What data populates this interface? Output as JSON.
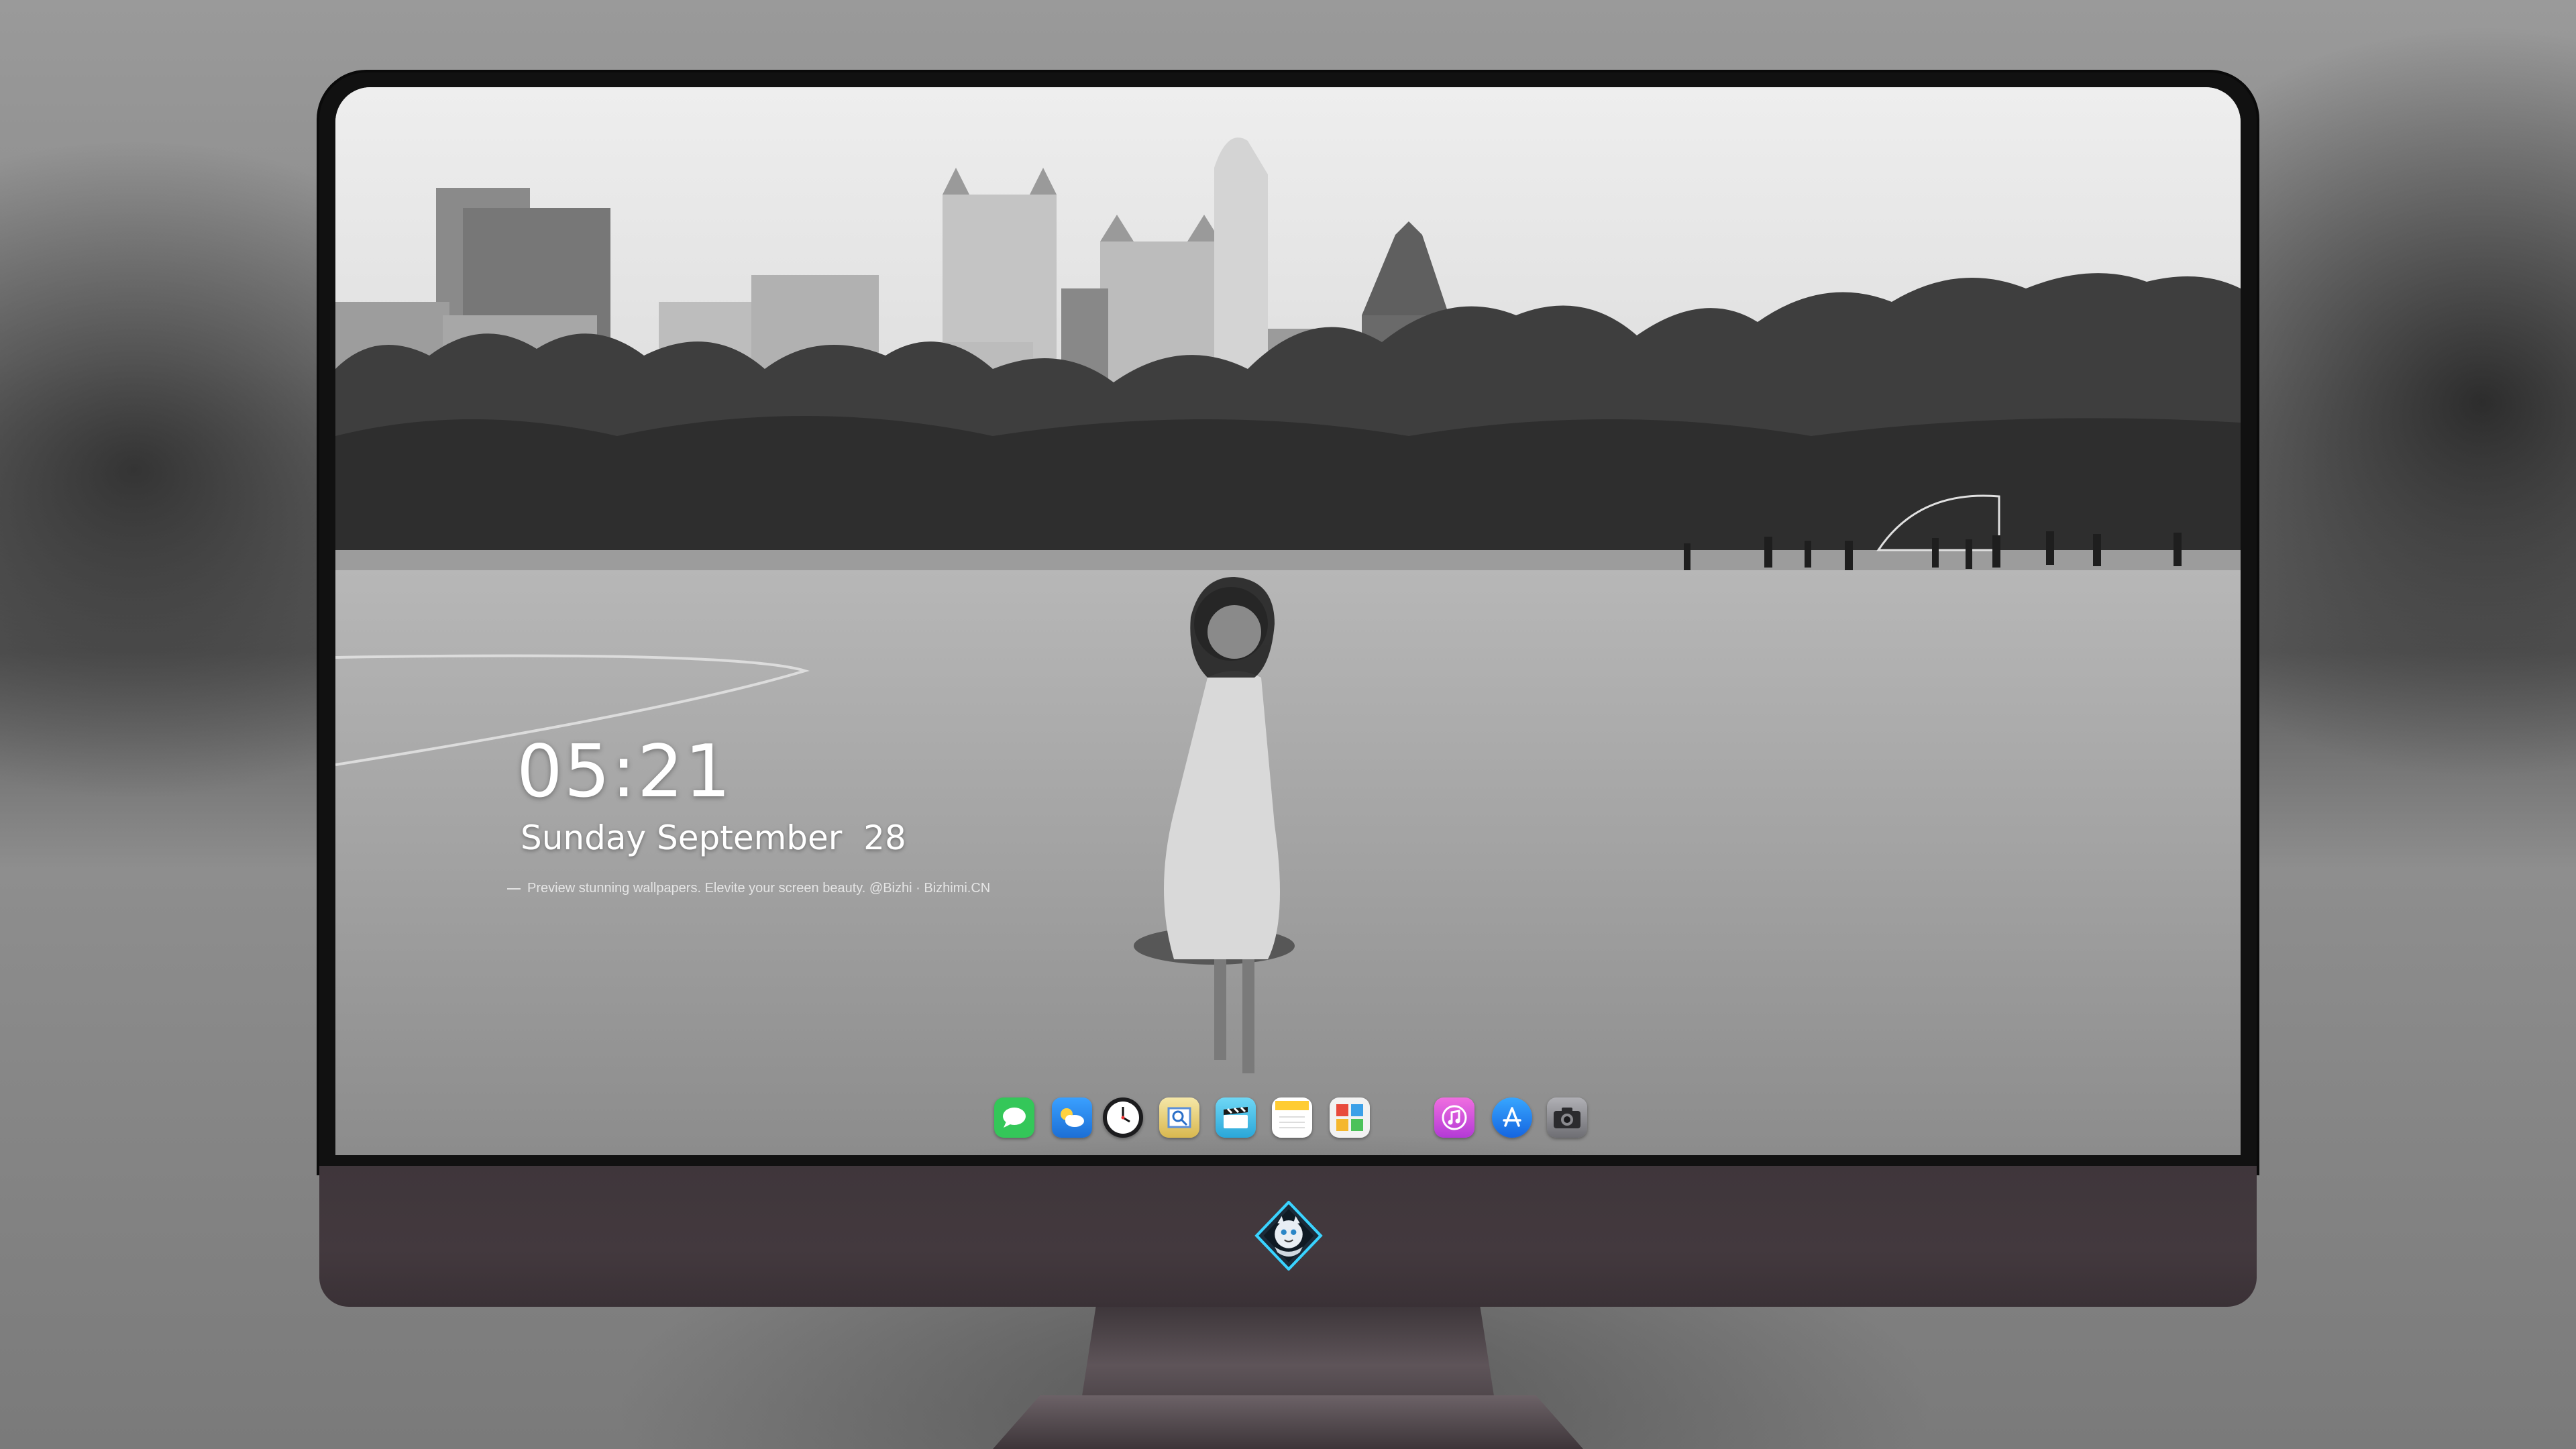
{
  "lockscreen": {
    "time": "05:21",
    "date": "Sunday September  28",
    "caption": "Preview stunning wallpapers. Elevite your screen beauty. @Bizhi · Bizhimi.CN"
  },
  "dock": {
    "apps": [
      {
        "name": "Messages",
        "icon": "messages-icon",
        "color": "#34c759"
      },
      {
        "name": "Weather",
        "icon": "weather-icon",
        "color": "#2f8ef0"
      },
      {
        "name": "Clock",
        "icon": "clock-icon",
        "color": "#1c1c1e"
      },
      {
        "name": "Preview",
        "icon": "preview-icon",
        "color": "#e8d27a"
      },
      {
        "name": "Clips",
        "icon": "clips-icon",
        "color": "#4fc3e8"
      },
      {
        "name": "Notes",
        "icon": "notes-icon",
        "color": "#ffd84a"
      },
      {
        "name": "Photo Booth",
        "icon": "photo-booth-icon",
        "color": "#f2f2f2"
      },
      {
        "name": "iTunes",
        "icon": "itunes-icon",
        "color": "#e74cd9"
      },
      {
        "name": "App Store",
        "icon": "app-store-icon",
        "color": "#1f8cf6"
      },
      {
        "name": "Camera",
        "icon": "camera-icon",
        "color": "#8e8e93"
      }
    ]
  },
  "hardware": {
    "logo": "dragon-mascot-logo"
  }
}
